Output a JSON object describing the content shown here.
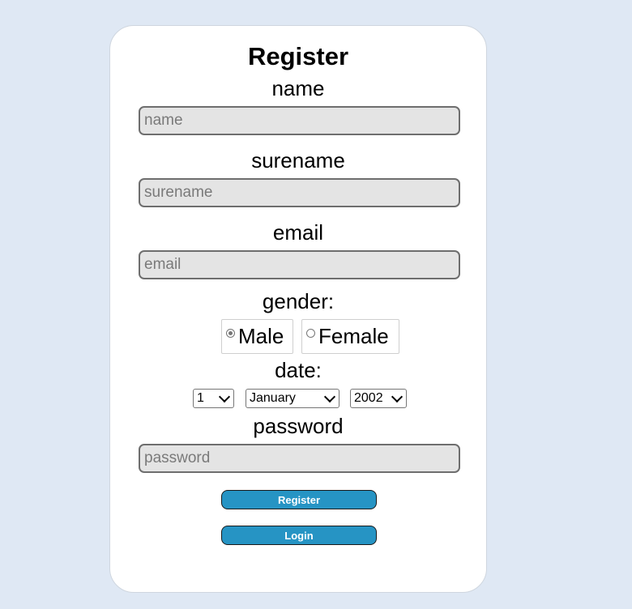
{
  "form": {
    "title": "Register",
    "name": {
      "label": "name",
      "placeholder": "name"
    },
    "surename": {
      "label": "surename",
      "placeholder": "surename"
    },
    "email": {
      "label": "email",
      "placeholder": "email"
    },
    "gender": {
      "label": "gender:",
      "options": [
        {
          "label": "Male",
          "checked": true
        },
        {
          "label": "Female",
          "checked": false
        }
      ]
    },
    "date": {
      "label": "date:",
      "day": "1",
      "month": "January",
      "year": "2002"
    },
    "password": {
      "label": "password",
      "placeholder": "password"
    },
    "register_button": "Register",
    "login_button": "Login"
  },
  "colors": {
    "page_background": "#dfe8f4",
    "button": "#2694c4",
    "input_background": "#e4e4e4"
  }
}
